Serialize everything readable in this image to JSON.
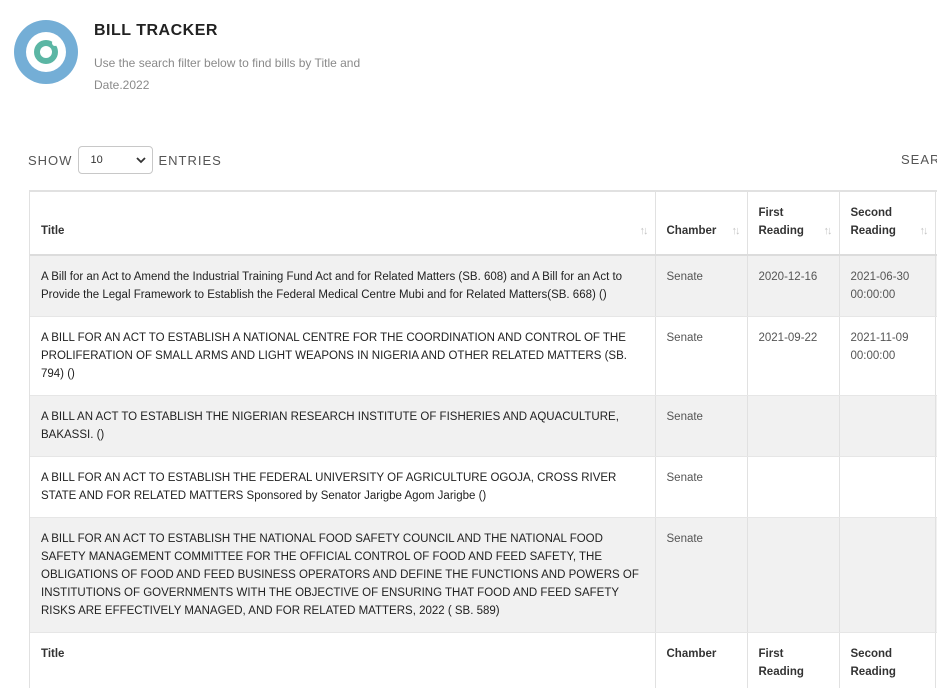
{
  "header": {
    "title": "BILL TRACKER",
    "subtitle": "Use the search filter below to find bills by Title and Date.2022"
  },
  "controls": {
    "show_label": "SHOW",
    "entries_value": "10",
    "entries_label": "ENTRIES",
    "search_label": "SEARCH:"
  },
  "table": {
    "columns": [
      "Title",
      "Chamber",
      "First Reading",
      "Second Reading"
    ],
    "rows": [
      {
        "title": "A Bill for an Act to Amend the Industrial Training Fund Act and for Related Matters (SB. 608) and A Bill for an Act to Provide the Legal Framework to Establish the Federal Medical Centre Mubi and for Related Matters(SB. 668) ()",
        "chamber": "Senate",
        "first_reading": "2020-12-16",
        "second_reading": "2021-06-30 00:00:00"
      },
      {
        "title": "A BILL FOR AN ACT TO ESTABLISH A NATIONAL CENTRE FOR THE COORDINATION AND CONTROL OF THE PROLIFERATION OF SMALL ARMS AND LIGHT WEAPONS IN NIGERIA AND OTHER RELATED MATTERS (SB. 794) ()",
        "chamber": "Senate",
        "first_reading": "2021-09-22",
        "second_reading": "2021-11-09 00:00:00"
      },
      {
        "title": "A BILL AN ACT TO ESTABLISH THE NIGERIAN RESEARCH INSTITUTE OF FISHERIES AND AQUACULTURE, BAKASSI. ()",
        "chamber": "Senate",
        "first_reading": "",
        "second_reading": ""
      },
      {
        "title": "A BILL FOR AN ACT TO ESTABLISH THE FEDERAL UNIVERSITY OF AGRICULTURE OGOJA, CROSS RIVER STATE AND FOR RELATED MATTERS Sponsored by Senator Jarigbe Agom Jarigbe ()",
        "chamber": "Senate",
        "first_reading": "",
        "second_reading": ""
      },
      {
        "title": "A BILL FOR AN ACT TO ESTABLISH THE NATIONAL FOOD SAFETY COUNCIL AND THE NATIONAL FOOD SAFETY MANAGEMENT COMMITTEE FOR THE OFFICIAL CONTROL OF FOOD AND FEED SAFETY, THE OBLIGATIONS OF FOOD AND FEED BUSINESS OPERATORS AND DEFINE THE FUNCTIONS AND POWERS OF INSTITUTIONS OF GOVERNMENTS WITH THE OBJECTIVE OF ENSURING THAT FOOD AND FEED SAFETY RISKS ARE EFFECTIVELY MANAGED, AND FOR RELATED MATTERS, 2022 ( SB. 589)",
        "chamber": "Senate",
        "first_reading": "",
        "second_reading": ""
      }
    ]
  },
  "colors": {
    "logo_ring": "#74aed6",
    "logo_iris": "#5bb6a4",
    "stripe": "#f1f1f1"
  },
  "icons": {
    "logo": "eye-logo-icon",
    "sort": "sort-arrows-icon",
    "dropdown": "chevron-down-icon"
  }
}
